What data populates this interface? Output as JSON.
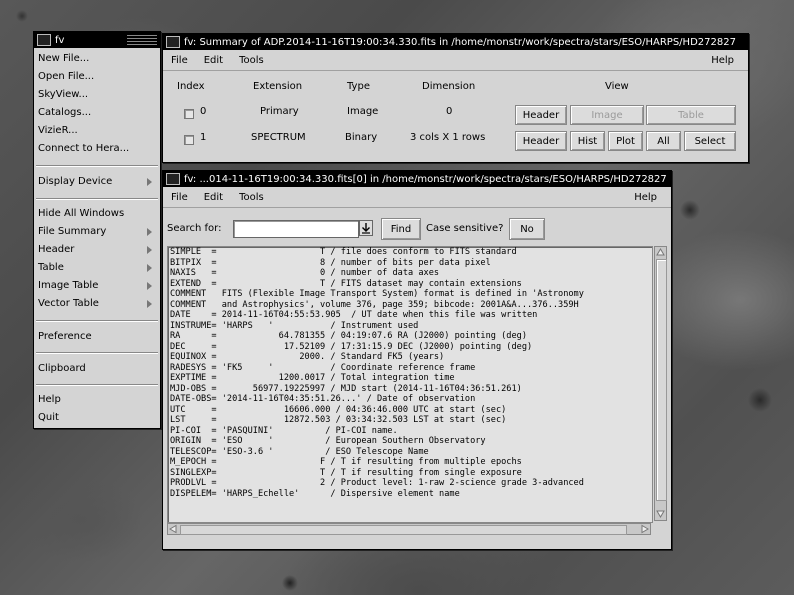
{
  "main_menu": {
    "title": "fv",
    "items": [
      "New File...",
      "Open File...",
      "SkyView...",
      "Catalogs...",
      "VizieR...",
      "Connect to Hera..."
    ],
    "display_device": "Display Device",
    "items2": [
      "Hide All Windows",
      "File Summary",
      "Header",
      "Table",
      "Image Table",
      "Vector Table"
    ],
    "preference": "Preference",
    "clipboard": "Clipboard",
    "help": "Help",
    "quit": "Quit"
  },
  "summary": {
    "title": "fv: Summary of ADP.2014-11-16T19:00:34.330.fits in /home/monstr/work/spectra/stars/ESO/HARPS/HD272827",
    "menu": {
      "file": "File",
      "edit": "Edit",
      "tools": "Tools",
      "help": "Help"
    },
    "columns": {
      "index": "Index",
      "extension": "Extension",
      "type": "Type",
      "dimension": "Dimension",
      "view": "View"
    },
    "rows": [
      {
        "index": "0",
        "extension": "Primary",
        "type": "Image",
        "dimension": "0",
        "buttons": [
          "Header",
          "Image",
          "Table"
        ]
      },
      {
        "index": "1",
        "extension": "SPECTRUM",
        "type": "Binary",
        "dimension": "3 cols X 1 rows",
        "buttons": [
          "Header",
          "Hist",
          "Plot",
          "All",
          "Select"
        ]
      }
    ]
  },
  "header_win": {
    "title": "fv: ...014-11-16T19:00:34.330.fits[0] in /home/monstr/work/spectra/stars/ESO/HARPS/HD272827",
    "menu": {
      "file": "File",
      "edit": "Edit",
      "tools": "Tools",
      "help": "Help"
    },
    "search_label": "Search for:",
    "search_value": "",
    "find": "Find",
    "case_label": "Case sensitive?",
    "case_value": "No",
    "lines": [
      "SIMPLE  =                    T / file does conform to FITS standard",
      "BITPIX  =                    8 / number of bits per data pixel",
      "NAXIS   =                    0 / number of data axes",
      "EXTEND  =                    T / FITS dataset may contain extensions",
      "COMMENT   FITS (Flexible Image Transport System) format is defined in 'Astronomy",
      "COMMENT   and Astrophysics', volume 376, page 359; bibcode: 2001A&A...376..359H",
      "DATE    = 2014-11-16T04:55:53.905  / UT date when this file was written",
      "INSTRUME= 'HARPS   '           / Instrument used",
      "RA      =            64.781355 / 04:19:07.6 RA (J2000) pointing (deg)",
      "DEC     =             17.52109 / 17:31:15.9 DEC (J2000) pointing (deg)",
      "EQUINOX =                2000. / Standard FK5 (years)",
      "RADESYS = 'FK5     '           / Coordinate reference frame",
      "EXPTIME =            1200.0017 / Total integration time",
      "MJD-OBS =       56977.19225997 / MJD start (2014-11-16T04:36:51.261)",
      "DATE-OBS= '2014-11-16T04:35:51.26...' / Date of observation",
      "UTC     =             16606.000 / 04:36:46.000 UTC at start (sec)",
      "LST     =             12872.503 / 03:34:32.503 LST at start (sec)",
      "PI-COI  = 'PASQUINI'          / PI-COI name.",
      "ORIGIN  = 'ESO     '          / European Southern Observatory",
      "TELESCOP= 'ESO-3.6 '          / ESO Telescope Name",
      "M_EPOCH =                    F / T if resulting from multiple epochs",
      "SINGLEXP=                    T / T if resulting from single exposure",
      "PRODLVL =                    2 / Product level: 1-raw 2-science grade 3-advanced",
      "DISPELEM= 'HARPS_Echelle'      / Dispersive element name"
    ]
  }
}
